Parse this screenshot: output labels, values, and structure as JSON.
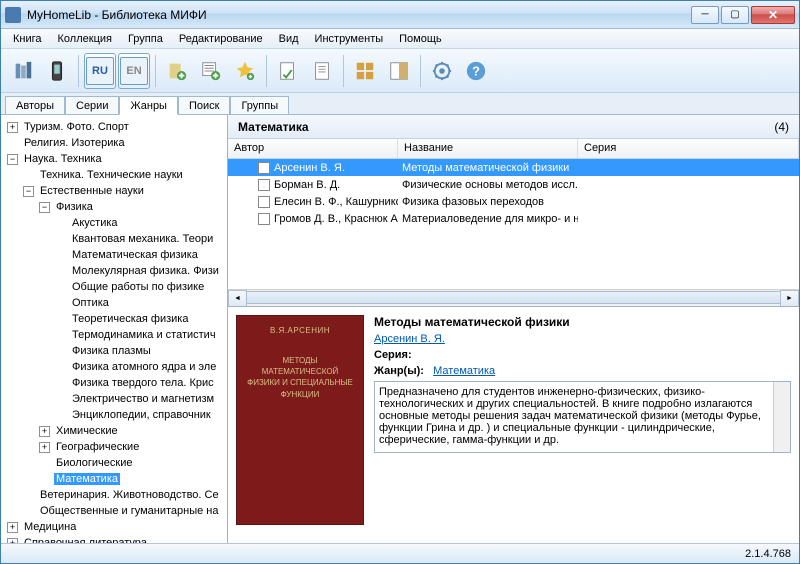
{
  "window": {
    "title": "MyHomeLib - Библиотека МИФИ"
  },
  "menu": [
    "Книга",
    "Коллекция",
    "Группа",
    "Редактирование",
    "Вид",
    "Инструменты",
    "Помощь"
  ],
  "tabs": [
    "Авторы",
    "Серии",
    "Жанры",
    "Поиск",
    "Группы"
  ],
  "active_tab": 2,
  "tree": [
    {
      "d": 0,
      "exp": "+",
      "label": "Туризм. Фото. Спорт"
    },
    {
      "d": 0,
      "exp": "",
      "label": "Религия. Изотерика"
    },
    {
      "d": 0,
      "exp": "-",
      "label": "Наука. Техника"
    },
    {
      "d": 1,
      "exp": "",
      "label": "Техника. Технические науки"
    },
    {
      "d": 1,
      "exp": "-",
      "label": "Естественные науки"
    },
    {
      "d": 2,
      "exp": "-",
      "label": "Физика"
    },
    {
      "d": 3,
      "exp": "",
      "label": "Акустика"
    },
    {
      "d": 3,
      "exp": "",
      "label": "Квантовая механика. Теори"
    },
    {
      "d": 3,
      "exp": "",
      "label": "Математическая физика"
    },
    {
      "d": 3,
      "exp": "",
      "label": "Молекулярная физика. Физи"
    },
    {
      "d": 3,
      "exp": "",
      "label": "Общие работы по физике"
    },
    {
      "d": 3,
      "exp": "",
      "label": "Оптика"
    },
    {
      "d": 3,
      "exp": "",
      "label": "Теоретическая физика"
    },
    {
      "d": 3,
      "exp": "",
      "label": "Термодинамика и статистич"
    },
    {
      "d": 3,
      "exp": "",
      "label": "Физика плазмы"
    },
    {
      "d": 3,
      "exp": "",
      "label": "Физика атомного ядра и эле"
    },
    {
      "d": 3,
      "exp": "",
      "label": "Физика твердого тела. Крис"
    },
    {
      "d": 3,
      "exp": "",
      "label": "Электричество и магнетизм"
    },
    {
      "d": 3,
      "exp": "",
      "label": "Энциклопедии, справочник"
    },
    {
      "d": 2,
      "exp": "+",
      "label": "Химические"
    },
    {
      "d": 2,
      "exp": "+",
      "label": "Географические"
    },
    {
      "d": 2,
      "exp": "",
      "label": "Биологические"
    },
    {
      "d": 2,
      "exp": "",
      "label": "Математика",
      "sel": true
    },
    {
      "d": 1,
      "exp": "",
      "label": "Ветеринария. Животноводство. Се"
    },
    {
      "d": 1,
      "exp": "",
      "label": "Общественные и гуманитарные на"
    },
    {
      "d": 0,
      "exp": "+",
      "label": "Медицина"
    },
    {
      "d": 0,
      "exp": "+",
      "label": "Справочная литература"
    }
  ],
  "category": {
    "name": "Математика",
    "count": "(4)"
  },
  "columns": [
    "Автор",
    "Название",
    "Серия"
  ],
  "rows": [
    {
      "author": "Арсенин В. Я.",
      "title": "Методы математической физики",
      "series": "",
      "sel": true
    },
    {
      "author": "Борман В. Д.",
      "title": "Физические основы методов иссл...",
      "series": ""
    },
    {
      "author": "Елесин В. Ф., Кашурников ...",
      "title": "Физика фазовых переходов",
      "series": ""
    },
    {
      "author": "Громов Д. В., Краснюк А. А.",
      "title": "Материаловедение для микро- и н...",
      "series": ""
    }
  ],
  "detail": {
    "title": "Методы математической физики",
    "author": "Арсенин В. Я.",
    "series_label": "Серия:",
    "genres_label": "Жанр(ы):",
    "genre": "Математика",
    "cover_author": "В.Я.АРСЕНИН",
    "cover_title": "МЕТОДЫ МАТЕМАТИЧЕСКОЙ ФИЗИКИ И СПЕЦИАЛЬНЫЕ ФУНКЦИИ",
    "description": "Предназначено для студентов инженерно-физических, физико- технологических и других специальностей. В книге подробно излагаются основные методы решения задач математической физики (методы Фурье, функции Грина и др. ) и специальные функции - цилиндрические, сферические, гамма-функции и др."
  },
  "status": {
    "version": "2.1.4.768"
  }
}
